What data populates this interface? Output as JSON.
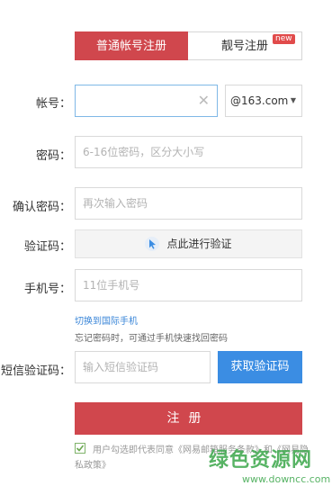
{
  "tabs": {
    "normal": "普通帐号注册",
    "premium": "靓号注册",
    "badge": "new"
  },
  "form": {
    "account": {
      "label": "帐号：",
      "value": "",
      "placeholder": ""
    },
    "domain": {
      "selected": "@163.com"
    },
    "password": {
      "label": "密码：",
      "placeholder": "6-16位密码，区分大小写"
    },
    "confirm": {
      "label": "确认密码：",
      "placeholder": "再次输入密码"
    },
    "captcha": {
      "label": "验证码：",
      "button": "点此进行验证"
    },
    "phone": {
      "label": "手机号：",
      "placeholder": "11位手机号"
    },
    "intl_link": "切换到国际手机",
    "hint": "忘记密码时，可通过手机快速找回密码",
    "sms": {
      "label": "短信验证码：",
      "placeholder": "输入短信验证码",
      "button": "获取验证码"
    },
    "register": "注册",
    "agreement": "用户勾选即代表同意《网易邮箱服务条款》和《网易隐私政策》"
  },
  "colors": {
    "accent_red": "#d0474d",
    "accent_blue": "#3b8de3"
  },
  "watermark": {
    "text": "绿色资源网",
    "url": "www.downcc.com"
  }
}
